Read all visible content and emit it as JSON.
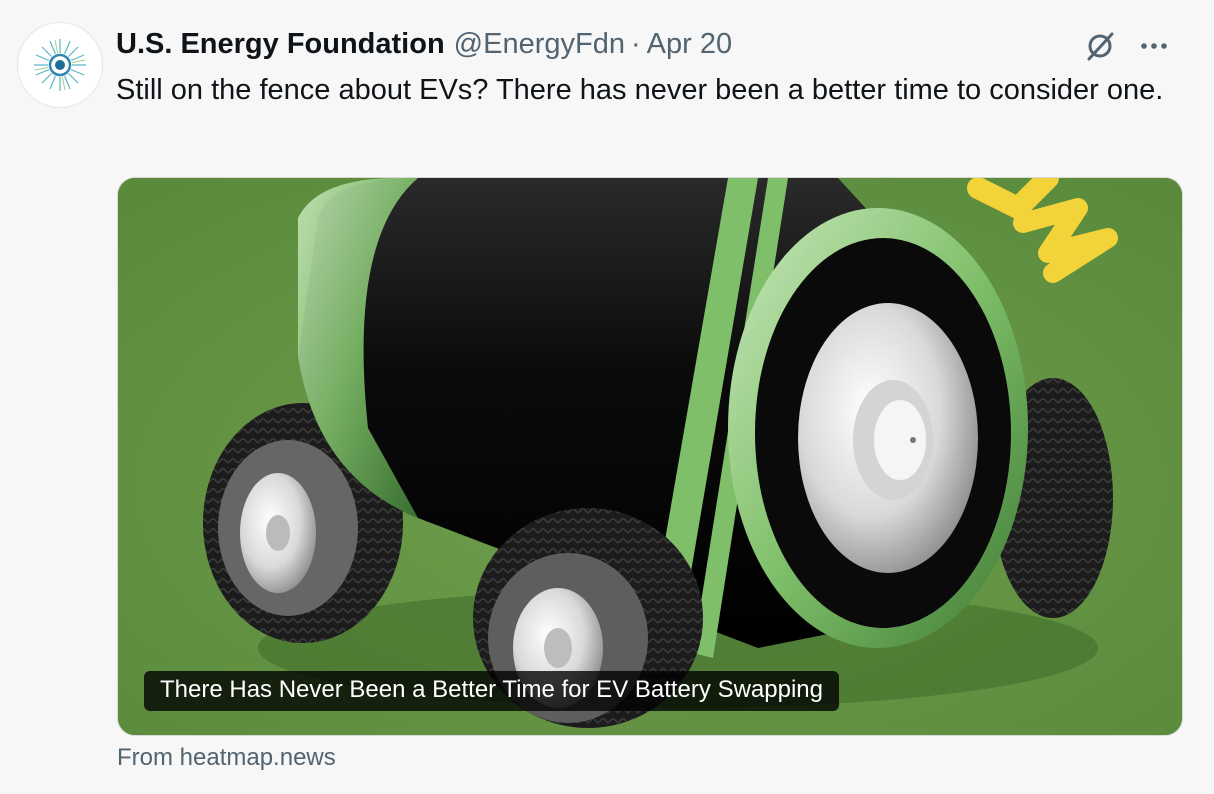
{
  "tweet": {
    "author_name": "U.S. Energy Foundation",
    "handle": "@EnergyFdn",
    "separator": "·",
    "date": "Apr 20",
    "text": "Still on the fence about EVs? There has never been a better time to consider one.",
    "more_label": "···"
  },
  "card": {
    "image_subject": "battery-on-wheels",
    "caption": "There Has Never Been a Better Time for EV Battery Swapping",
    "source": "From heatmap.news"
  },
  "colors": {
    "card_background": "#6b9a4a",
    "accent_yellow": "#f2d33a",
    "secondary_text": "#536471"
  }
}
